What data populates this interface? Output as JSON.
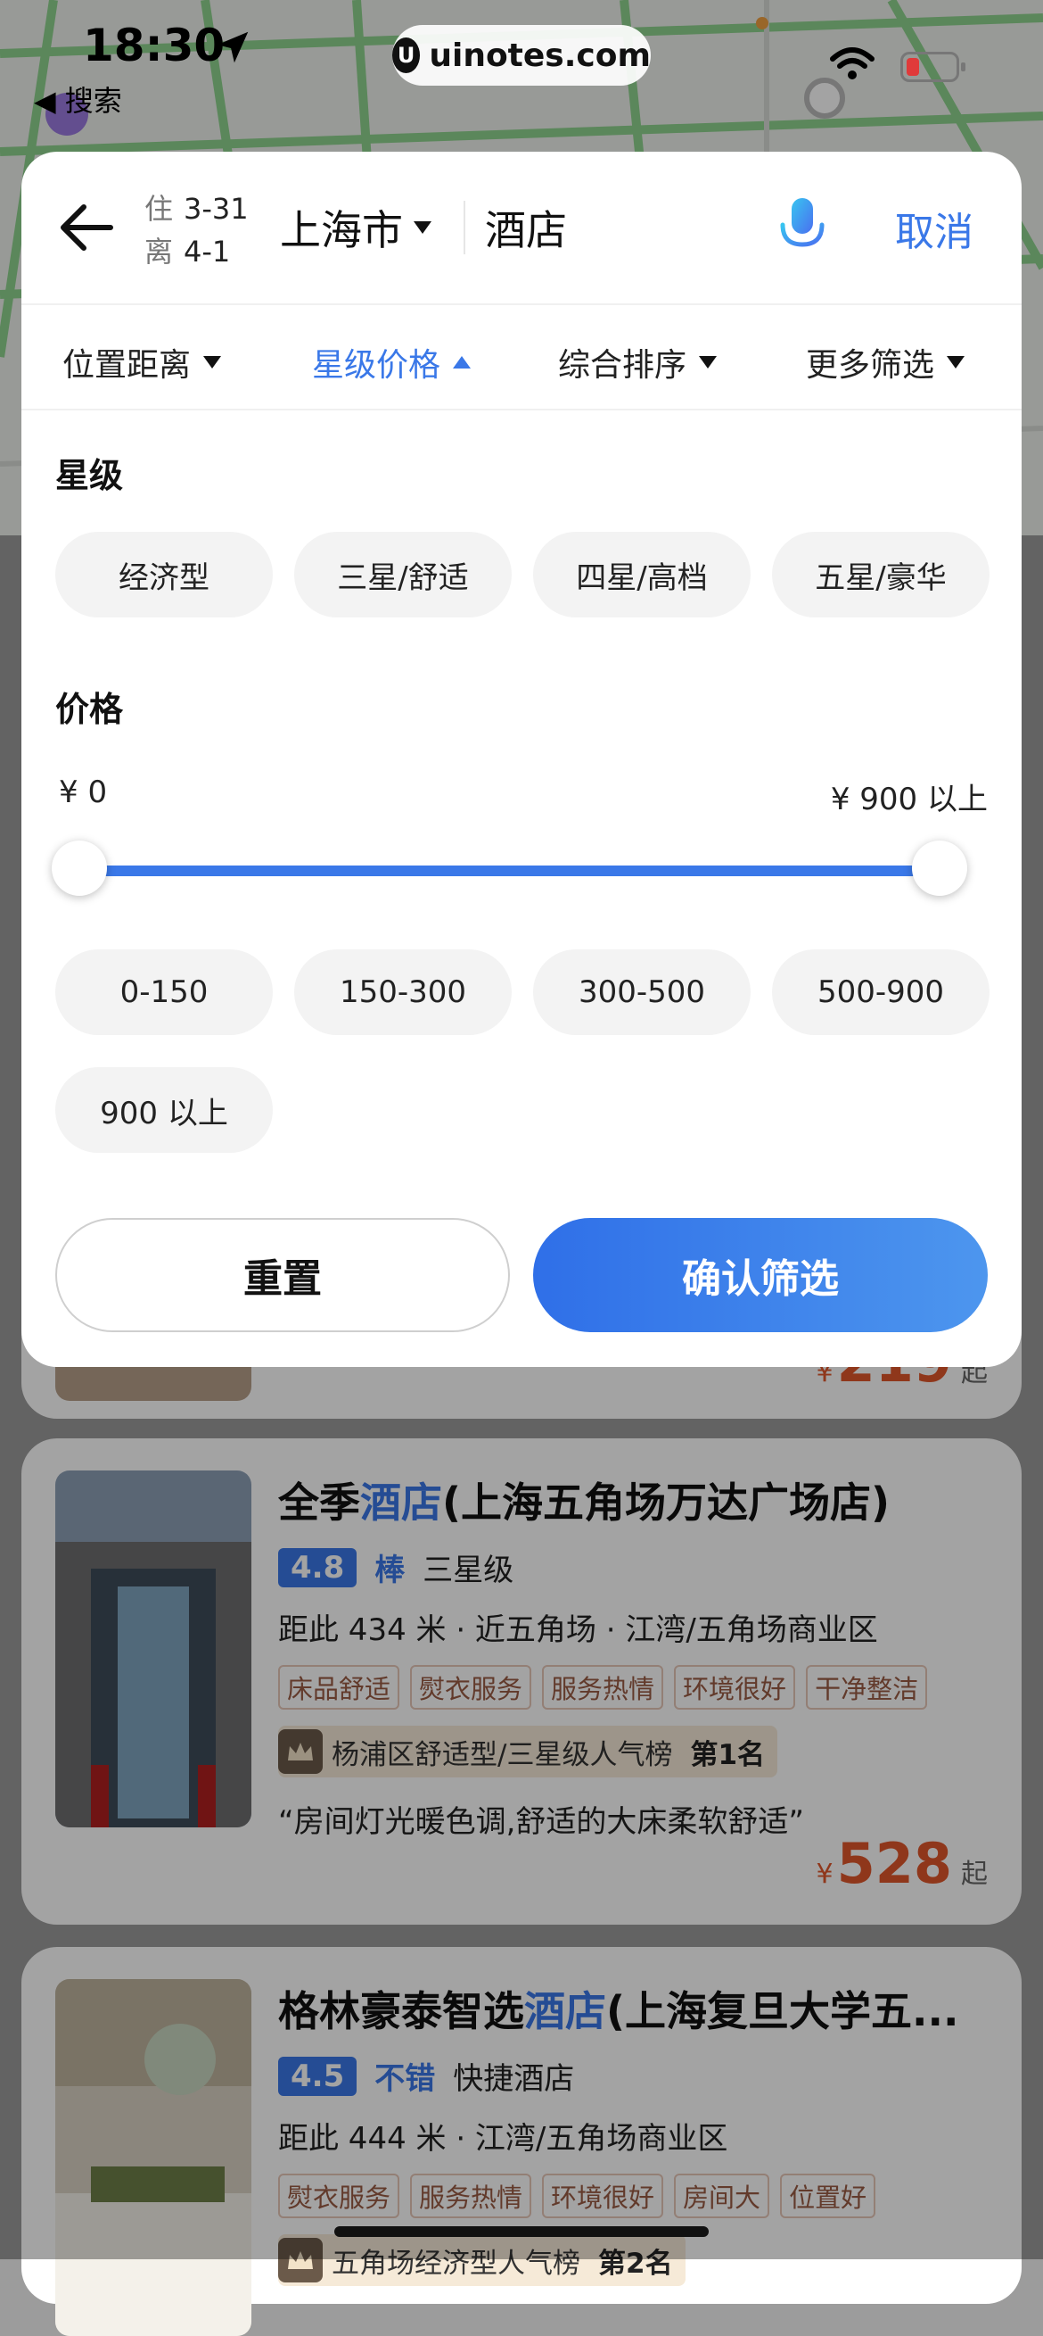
{
  "status_bar": {
    "time": "18:30",
    "back_app": "◀ 搜索",
    "url": "uinotes.com",
    "battery_color": "#e03a3a"
  },
  "search": {
    "checkin_key": "住",
    "checkin_date": "3-31",
    "checkout_key": "离",
    "checkout_date": "4-1",
    "city": "上海市",
    "query": "酒店",
    "cancel": "取消"
  },
  "tabs": [
    {
      "label": "位置距离",
      "active": false
    },
    {
      "label": "星级价格",
      "active": true
    },
    {
      "label": "综合排序",
      "active": false
    },
    {
      "label": "更多筛选",
      "active": false
    }
  ],
  "star_section": {
    "title": "星级",
    "options": [
      "经济型",
      "三星/舒适",
      "四星/高档",
      "五星/豪华"
    ]
  },
  "price_section": {
    "title": "价格",
    "min_label": "¥ 0",
    "max_label": "¥ 900 以上",
    "slider_min_fraction": 0,
    "slider_max_fraction": 1,
    "options": [
      "0-150",
      "150-300",
      "300-500",
      "500-900",
      "900 以上"
    ]
  },
  "actions": {
    "reset": "重置",
    "confirm": "确认筛选"
  },
  "hotels": [
    {
      "name_prefix": "全季",
      "name_highlight": "酒店",
      "name_suffix": "(上海五角场万达广场店)",
      "score": "4.8",
      "rating_word": "棒",
      "star_level": "三星级",
      "distance": "距此 434 米 · 近五角场 · 江湾/五角场商业区",
      "tags": [
        "床品舒适",
        "熨衣服务",
        "服务热情",
        "环境很好",
        "干净整洁"
      ],
      "rank_text": "杨浦区舒适型/三星级人气榜",
      "rank_no": "第1名",
      "quote": "“房间灯光暖色调,舒适的大床柔软舒适”",
      "currency": "¥",
      "price": "528",
      "price_suffix": "起"
    },
    {
      "name_prefix": "格林豪泰智选",
      "name_highlight": "酒店",
      "name_suffix": "(上海复旦大学五...",
      "score": "4.5",
      "rating_word": "不错",
      "star_level": "快捷酒店",
      "distance": "距此 444 米 · 江湾/五角场商业区",
      "tags": [
        "熨衣服务",
        "服务热情",
        "环境很好",
        "房间大",
        "位置好"
      ],
      "rank_text": "五角场经济型人气榜",
      "rank_no": "第2名"
    }
  ],
  "colors": {
    "accent": "#3a78e8",
    "price": "#e0572b",
    "chip_bg": "#f3f3f3"
  }
}
